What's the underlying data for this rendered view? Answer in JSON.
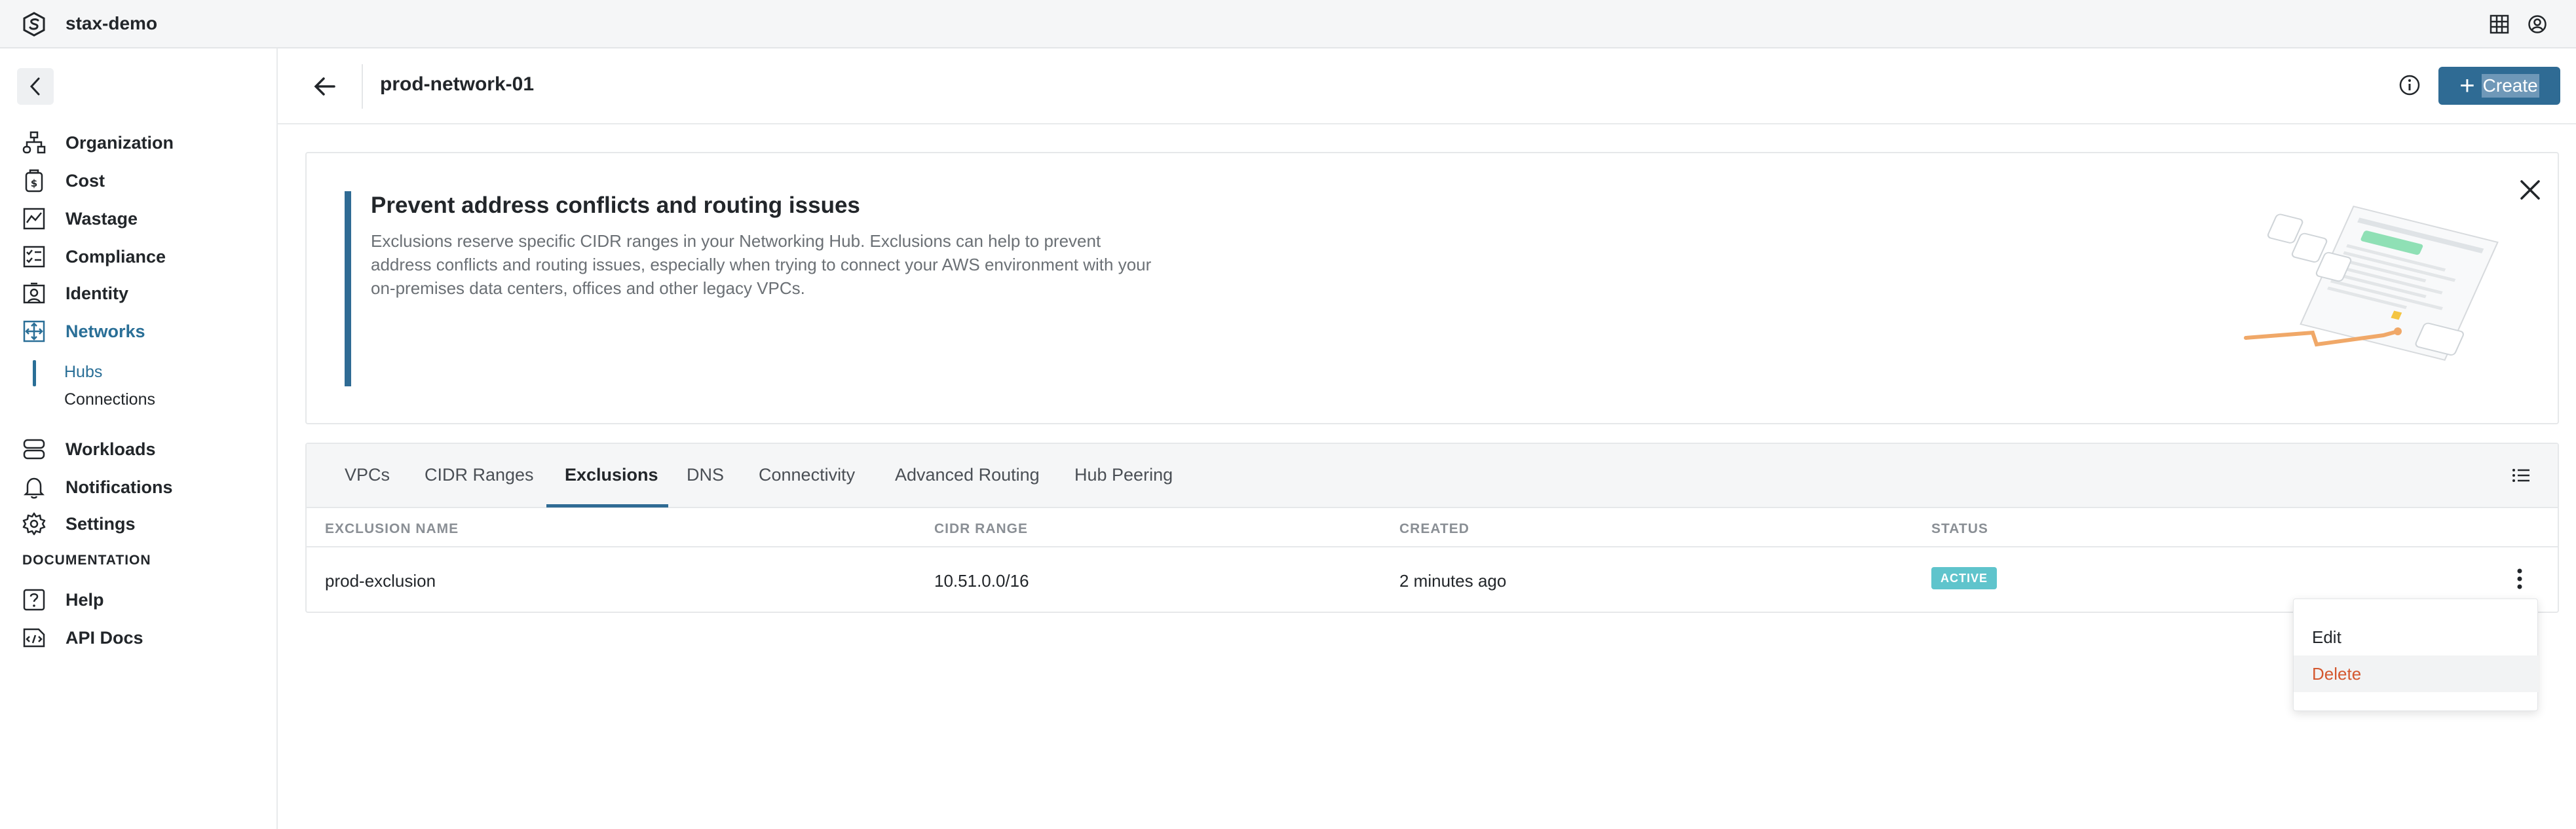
{
  "app": {
    "name": "stax-demo"
  },
  "sidebar": {
    "items": [
      {
        "label": "Organization",
        "icon": "organization-icon"
      },
      {
        "label": "Cost",
        "icon": "cost-icon"
      },
      {
        "label": "Wastage",
        "icon": "wastage-icon"
      },
      {
        "label": "Compliance",
        "icon": "compliance-icon"
      },
      {
        "label": "Identity",
        "icon": "identity-icon"
      },
      {
        "label": "Networks",
        "icon": "networks-icon",
        "active": true
      },
      {
        "label": "Workloads",
        "icon": "workloads-icon"
      },
      {
        "label": "Notifications",
        "icon": "bell-icon"
      },
      {
        "label": "Settings",
        "icon": "gear-icon"
      }
    ],
    "networks_sub": [
      {
        "label": "Hubs",
        "active": true
      },
      {
        "label": "Connections"
      }
    ],
    "documentation_label": "DOCUMENTATION",
    "doc_items": [
      {
        "label": "Help",
        "icon": "help-icon"
      },
      {
        "label": "API Docs",
        "icon": "api-docs-icon"
      }
    ]
  },
  "header": {
    "title": "prod-network-01",
    "create_label": "Create"
  },
  "banner": {
    "title": "Prevent address conflicts and routing issues",
    "description": "Exclusions reserve specific CIDR ranges in your Networking Hub. Exclusions can help to prevent address conflicts and routing issues, especially when trying to connect your AWS environment with your on-premises data centers, offices and other legacy VPCs."
  },
  "tabs": [
    "VPCs",
    "CIDR Ranges",
    "Exclusions",
    "DNS",
    "Connectivity",
    "Advanced Routing",
    "Hub Peering"
  ],
  "active_tab": "Exclusions",
  "table": {
    "columns": [
      "EXCLUSION NAME",
      "CIDR RANGE",
      "CREATED",
      "STATUS"
    ],
    "rows": [
      {
        "name": "prod-exclusion",
        "cidr": "10.51.0.0/16",
        "created": "2 minutes ago",
        "status": "ACTIVE"
      }
    ]
  },
  "row_menu": {
    "edit": "Edit",
    "delete": "Delete"
  },
  "colors": {
    "accent": "#2f6b94",
    "active_badge": "#5fc4cc",
    "danger": "#d4582f"
  }
}
